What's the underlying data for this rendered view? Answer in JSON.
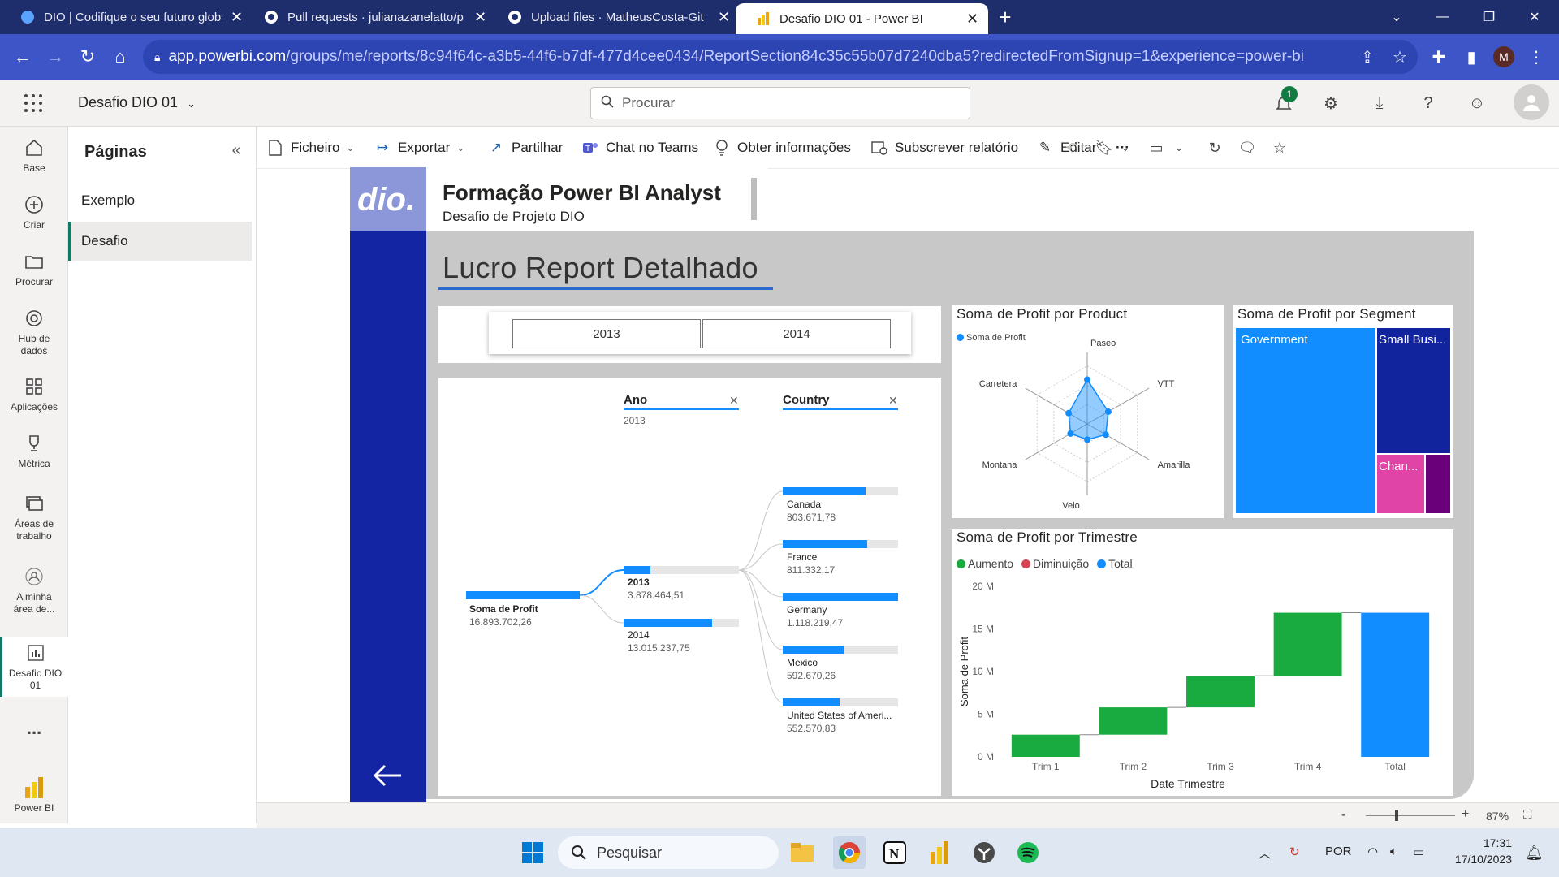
{
  "browser": {
    "tabs": [
      {
        "title": "DIO | Codifique o seu futuro global",
        "active": false
      },
      {
        "title": "Pull requests · julianazanelatto/p",
        "active": false
      },
      {
        "title": "Upload files · MatheusCosta-Git",
        "active": false
      },
      {
        "title": "Desafio DIO 01 - Power BI",
        "active": true
      }
    ],
    "url_host": "app.powerbi.com",
    "url_path": "/groups/me/reports/8c94f64c-a3b5-44f6-b7df-477d4cee0434/ReportSection84c35c55b07d7240dba5?redirectedFromSignup=1&experience=power-bi",
    "profile_initial": "M"
  },
  "header": {
    "report_name": "Desafio DIO 01",
    "search_placeholder": "Procurar",
    "notification_count": "1"
  },
  "leftnav": {
    "items": [
      {
        "label": "Base",
        "icon": "home-icon"
      },
      {
        "label": "Criar",
        "icon": "plus-circle-icon"
      },
      {
        "label": "Procurar",
        "icon": "folder-icon"
      },
      {
        "label": "Hub de dados",
        "icon": "data-hub-icon"
      },
      {
        "label": "Aplicações",
        "icon": "apps-icon"
      },
      {
        "label": "Métrica",
        "icon": "trophy-icon"
      },
      {
        "label": "Áreas de trabalho",
        "icon": "workspaces-icon"
      },
      {
        "label": "A minha área de...",
        "icon": "person-icon"
      },
      {
        "label": "Desafio DIO 01",
        "icon": "report-icon"
      }
    ],
    "more": "...",
    "brand": "Power BI"
  },
  "pages": {
    "title": "Páginas",
    "items": [
      "Exemplo",
      "Desafio"
    ],
    "active": "Desafio"
  },
  "actions": {
    "file": "Ficheiro",
    "export": "Exportar",
    "share": "Partilhar",
    "teams": "Chat no Teams",
    "insights": "Obter informações",
    "subscribe": "Subscrever relatório",
    "edit": "Editar",
    "more": "···"
  },
  "report": {
    "title": "Formação Power BI Analyst",
    "subtitle": "Desafio de Projeto DIO",
    "section_title": "Lucro Report Detalhado",
    "slicer": [
      "2013",
      "2014"
    ]
  },
  "decomposition": {
    "root": {
      "label": "Soma de Profit",
      "value": "16.893.702,26"
    },
    "level1_header": "Ano",
    "level1_filter": "2013",
    "level2_header": "Country",
    "years": [
      {
        "label": "2013",
        "value": "3.878.464,51",
        "share": 0.23
      },
      {
        "label": "2014",
        "value": "13.015.237,75",
        "share": 0.77
      }
    ],
    "countries": [
      {
        "label": "Canada",
        "value": "803.671,78",
        "share": 0.72
      },
      {
        "label": "France",
        "value": "811.332,17",
        "share": 0.73
      },
      {
        "label": "Germany",
        "value": "1.118.219,47",
        "share": 1.0
      },
      {
        "label": "Mexico",
        "value": "592.670,26",
        "share": 0.53
      },
      {
        "label": "United States of Ameri...",
        "value": "552.570,83",
        "share": 0.49
      }
    ]
  },
  "chart_data": [
    {
      "type": "radar",
      "title": "Soma de Profit por Product",
      "legend": "Soma de Profit",
      "categories": [
        "Paseo",
        "VTT",
        "Amarilla",
        "Velo",
        "Montana",
        "Carretera"
      ],
      "values": [
        0.62,
        0.34,
        0.3,
        0.22,
        0.27,
        0.3
      ],
      "color": "#118dff"
    },
    {
      "type": "treemap",
      "title": "Soma de Profit por Segment",
      "items": [
        {
          "label": "Government",
          "color": "#118dff",
          "share": 0.6
        },
        {
          "label": "Small Busi...",
          "color": "#12239e",
          "share": 0.25
        },
        {
          "label": "Chan...",
          "color": "#e044a7",
          "share": 0.1
        },
        {
          "label": "",
          "color": "#6b007b",
          "share": 0.05
        }
      ]
    },
    {
      "type": "waterfall",
      "title": "Soma de Profit por Trimestre",
      "legend": [
        {
          "label": "Aumento",
          "color": "#1aab40"
        },
        {
          "label": "Diminuição",
          "color": "#d64554"
        },
        {
          "label": "Total",
          "color": "#118dff"
        }
      ],
      "categories": [
        "Trim 1",
        "Trim 2",
        "Trim 3",
        "Trim 4",
        "Total"
      ],
      "increments": [
        2.6,
        3.2,
        3.7,
        7.4
      ],
      "total": 16.9,
      "ylim": [
        0,
        20
      ],
      "yticks": [
        "0 M",
        "5 M",
        "10 M",
        "15 M",
        "20 M"
      ],
      "ylabel": "Soma de Profit",
      "xlabel": "Date Trimestre"
    }
  ],
  "status": {
    "zoom": "87%"
  },
  "taskbar": {
    "search": "Pesquisar",
    "lang": "POR",
    "time": "17:31",
    "date": "17/10/2023"
  }
}
